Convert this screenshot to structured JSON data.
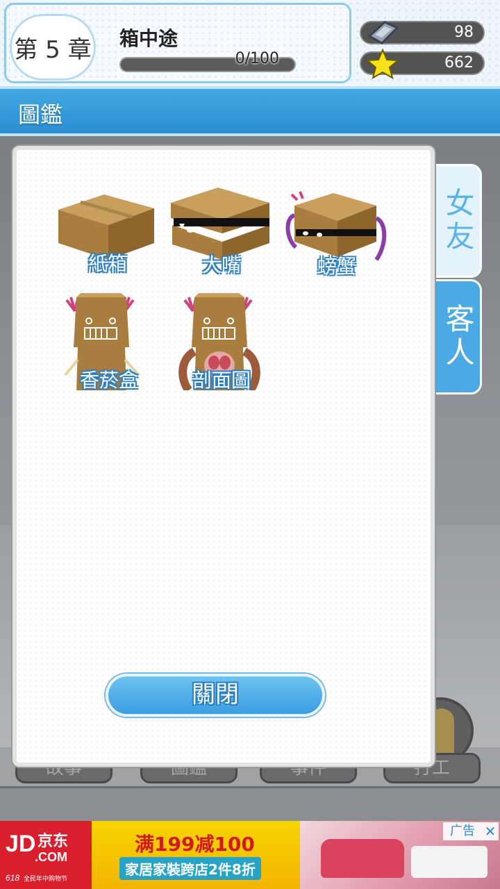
{
  "header": {
    "chapter": "第 5 章",
    "stage_title": "箱中途",
    "progress_text": "0/100",
    "progress_fraction": 0,
    "resources": [
      {
        "icon": "ticket-icon",
        "value": "98"
      },
      {
        "icon": "star-icon",
        "value": "662"
      }
    ]
  },
  "page_title": "圖鑑",
  "side_tabs": [
    {
      "label": "女友",
      "active": false
    },
    {
      "label": "客人",
      "active": true
    }
  ],
  "collection": {
    "items": [
      {
        "name": "紙箱",
        "icon": "cardboard-box-icon"
      },
      {
        "name": "大嘴",
        "icon": "big-mouth-box-icon"
      },
      {
        "name": "螃蟹",
        "icon": "crab-box-icon"
      },
      {
        "name": "香菸盒",
        "icon": "cigarette-box-icon"
      },
      {
        "name": "剖面圖",
        "icon": "cross-section-box-icon"
      }
    ]
  },
  "close_button": "關閉",
  "background_nav": [
    "故事",
    "圖鑑",
    "事件",
    "打工"
  ],
  "ad": {
    "brand": "JD",
    "brand_suffix": ".COM",
    "brand_cn": "京东",
    "brand_sub": "全民年中购物节",
    "event": "618",
    "headline": "满199减100",
    "tagline": "家居家裝跨店2件8折",
    "tag": "广告",
    "close": "✕"
  },
  "colors": {
    "accent_blue": "#3b9ce0",
    "title_bar": "#2b8fd0",
    "label_outline": "#2d7fc0"
  }
}
